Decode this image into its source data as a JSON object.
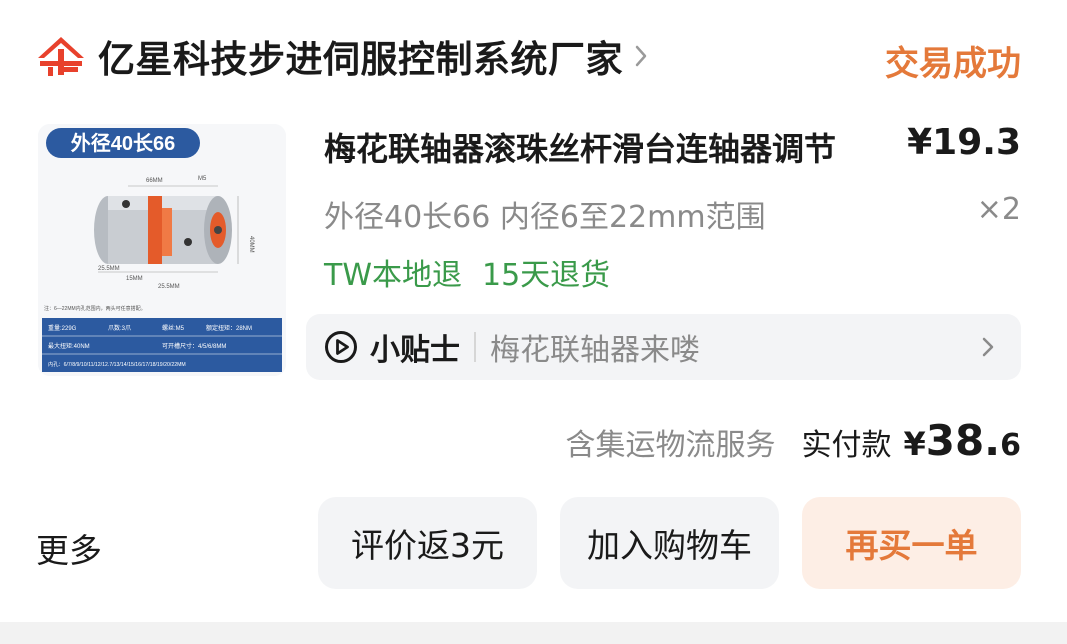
{
  "shop": {
    "logo_icon": "tmall-shop-logo-icon",
    "name": "亿星科技步进伺服控制系统厂家",
    "chevron_icon": "chevron-right-icon"
  },
  "order": {
    "status": "交易成功",
    "status_color": "#e4793a"
  },
  "product": {
    "image": {
      "banner_text": "外径40长66",
      "dim_top": "66MM",
      "dim_screw": "M5",
      "dim_right": "40MM",
      "dim_left": "25.5MM",
      "dim_mid": "15MM",
      "dim_right_bottom": "25.5MM",
      "note": "注：6—22MM内孔范围内，两头可任意搭配。",
      "spec_rows": [
        [
          "重量:229G",
          "爪数:3爪",
          "螺丝:M5",
          "额定扭矩：28NM"
        ],
        [
          "最大扭矩:40NM",
          "可开槽尺寸：4/5/6/8MM"
        ],
        [
          "内孔：6/7/8/9/10/11/12/12.7/13/14/15/16/17/18/19/20/22MM"
        ]
      ]
    },
    "title": "梅花联轴器滚珠丝杆滑台连轴器调节",
    "price": "¥19.3",
    "spec": "外径40长66 内径6至22mm范围",
    "quantity": "×2",
    "service_tags": [
      "TW本地退",
      "15天退货"
    ],
    "service_color": "#3a9a4a"
  },
  "tip": {
    "icon": "play-circle-icon",
    "label": "小贴士",
    "text": "梅花联轴器来喽",
    "chevron_icon": "chevron-right-icon"
  },
  "summary": {
    "shipping_note": "含集运物流服务",
    "paid_label": "实付款",
    "paid_symbol": "¥",
    "paid_int": "38.",
    "paid_dec": "6"
  },
  "actions": {
    "more": "更多",
    "review": "评价返3元",
    "add_cart": "加入购物车",
    "rebuy": "再买一单",
    "accent_color": "#e4793a"
  }
}
